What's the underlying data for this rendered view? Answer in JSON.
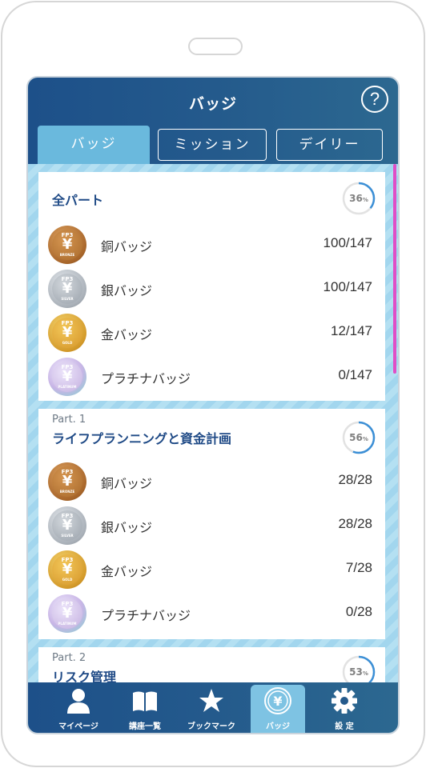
{
  "header": {
    "title": "バッジ",
    "help_label": "?"
  },
  "tabs": [
    {
      "label": "バッジ",
      "active": true
    },
    {
      "label": "ミッション",
      "active": false
    },
    {
      "label": "デイリー",
      "active": false
    }
  ],
  "sections": [
    {
      "part": "",
      "title": "全パート",
      "progress": {
        "value": "36",
        "unit": "%",
        "fraction": 0.36
      },
      "badges": [
        {
          "type": "bronze",
          "name": "銅バッジ",
          "count": "100/147"
        },
        {
          "type": "silver",
          "name": "銀バッジ",
          "count": "100/147"
        },
        {
          "type": "gold",
          "name": "金バッジ",
          "count": "12/147"
        },
        {
          "type": "platinum",
          "name": "プラチナバッジ",
          "count": "0/147"
        }
      ]
    },
    {
      "part": "Part. 1",
      "title": "ライフプランニングと資金計画",
      "progress": {
        "value": "56",
        "unit": "%",
        "fraction": 0.56
      },
      "badges": [
        {
          "type": "bronze",
          "name": "銅バッジ",
          "count": "28/28"
        },
        {
          "type": "silver",
          "name": "銀バッジ",
          "count": "28/28"
        },
        {
          "type": "gold",
          "name": "金バッジ",
          "count": "7/28"
        },
        {
          "type": "platinum",
          "name": "プラチナバッジ",
          "count": "0/28"
        }
      ]
    },
    {
      "part": "Part. 2",
      "title": "リスク管理",
      "progress": {
        "value": "53",
        "unit": "%",
        "fraction": 0.53
      },
      "badges": []
    }
  ],
  "coin_text": {
    "top": "FP3",
    "symbol": "¥",
    "bronze": "BRONZE",
    "silver": "SILVER",
    "gold": "GOLD",
    "platinum": "PLATINUM"
  },
  "bottom_nav": [
    {
      "label": "マイページ",
      "icon": "person-icon",
      "active": false
    },
    {
      "label": "講座一覧",
      "icon": "book-icon",
      "active": false
    },
    {
      "label": "ブックマーク",
      "icon": "star-icon",
      "active": false
    },
    {
      "label": "バッジ",
      "icon": "badge-coin-icon",
      "active": true
    },
    {
      "label": "設 定",
      "icon": "gear-icon",
      "active": false
    }
  ],
  "colors": {
    "header": "#245a8c",
    "accent": "#6ab9dd",
    "ring": "#3b8fd6",
    "scrollbar": "#e04ec6"
  }
}
